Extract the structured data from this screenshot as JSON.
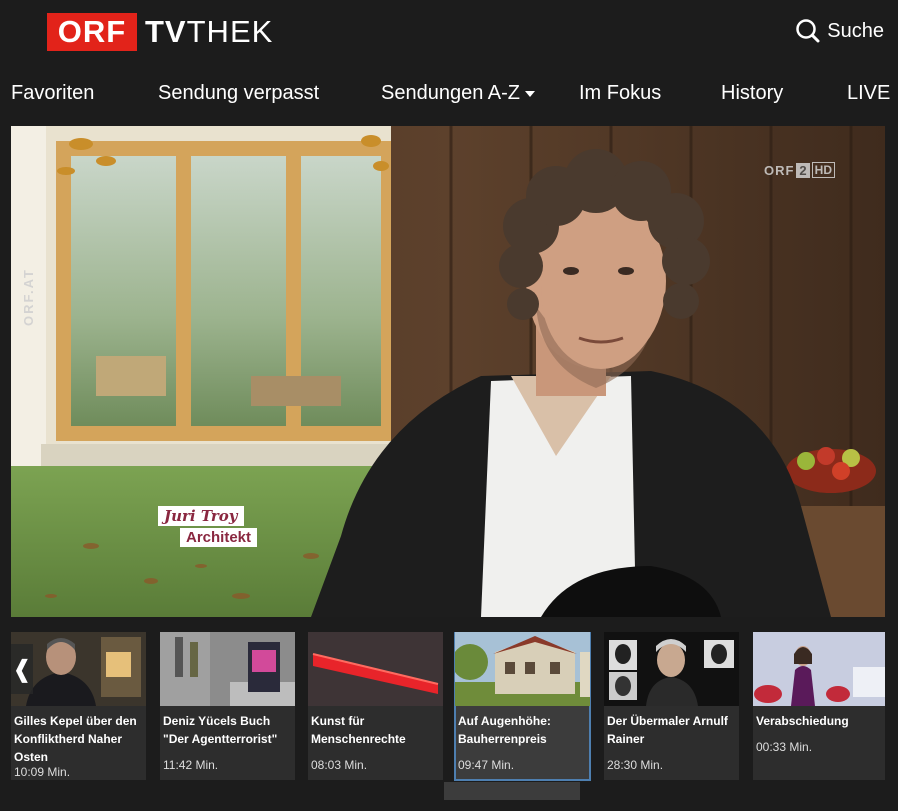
{
  "header": {
    "logo_orf": "ORF",
    "logo_tv": "TV",
    "logo_thek": "THEK",
    "search_label": "Suche",
    "search_icon": "search-icon"
  },
  "nav": {
    "items": [
      {
        "label": "Favoriten"
      },
      {
        "label": "Sendung verpasst"
      },
      {
        "label": "Sendungen A-Z",
        "dropdown": true
      },
      {
        "label": "Im Fokus"
      },
      {
        "label": "History"
      },
      {
        "label": "LIVE"
      }
    ]
  },
  "player": {
    "channel_logo_orf": "ORF",
    "channel_logo_num": "2",
    "channel_logo_hd": "HD",
    "watermark": "ORF.AT",
    "caption_name": "Juri Troy",
    "caption_role": "Architekt"
  },
  "carousel": {
    "prev_icon": "chevron-left-icon",
    "prev_glyph": "❰",
    "items": [
      {
        "title": "Gilles Kepel über den Konfliktherd Naher Osten",
        "duration": "10:09 Min."
      },
      {
        "title": "Deniz Yücels Buch \"Der Agentterrorist\"",
        "duration": "11:42 Min."
      },
      {
        "title": "Kunst für Menschenrechte",
        "duration": "08:03 Min."
      },
      {
        "title": "Auf Augenhöhe: Bauherrenpreis",
        "duration": "09:47 Min.",
        "active": true
      },
      {
        "title": "Der Übermaler Arnulf Rainer",
        "duration": "28:30 Min."
      },
      {
        "title": "Verabschiedung",
        "duration": "00:33 Min."
      }
    ]
  },
  "colors": {
    "brand_red": "#e2231a",
    "background": "#1c1c1c",
    "card_bg": "#2d2d2d",
    "active_border": "#4e7fb0"
  }
}
